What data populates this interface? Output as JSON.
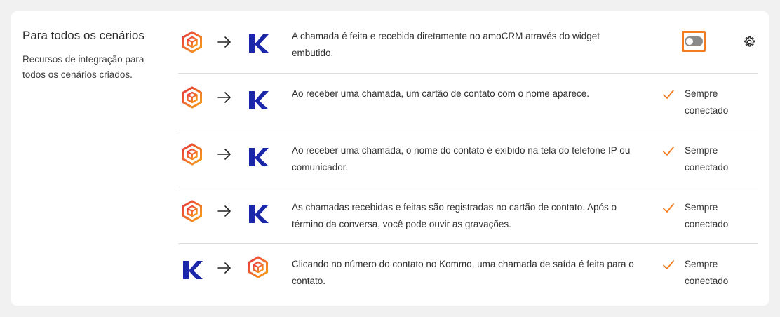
{
  "section": {
    "title": "Para todos os cenários",
    "subtitle": "Recursos de integração para todos os cenários criados."
  },
  "colors": {
    "accent": "#f47c20",
    "kommo_blue": "#1a27a8",
    "toggle_off": "#8a8a8a",
    "divider": "#dcdcdc"
  },
  "rows": [
    {
      "from_icon": "amocrm-hexagon-icon",
      "to_icon": "kommo-k-icon",
      "description": "A chamada é feita e recebida diretamente no amoCRM através do widget embutido.",
      "control": "toggle",
      "toggle_on": false
    },
    {
      "from_icon": "amocrm-hexagon-icon",
      "to_icon": "kommo-k-icon",
      "description": "Ao receber uma chamada, um cartão de contato com o nome aparece.",
      "status": "Sempre conectado"
    },
    {
      "from_icon": "amocrm-hexagon-icon",
      "to_icon": "kommo-k-icon",
      "description": "Ao receber uma chamada, o nome do contato é exibido na tela do telefone IP ou comunicador.",
      "status": "Sempre conectado"
    },
    {
      "from_icon": "amocrm-hexagon-icon",
      "to_icon": "kommo-k-icon",
      "description": "As chamadas recebidas e feitas são registradas no cartão de contato. Após o término da conversa, você pode ouvir as gravações.",
      "status": "Sempre conectado"
    },
    {
      "from_icon": "kommo-k-icon",
      "to_icon": "amocrm-hexagon-icon",
      "description": "Clicando no número do contato no Kommo, uma chamada de saída é feita para o contato.",
      "status": "Sempre conectado"
    }
  ]
}
